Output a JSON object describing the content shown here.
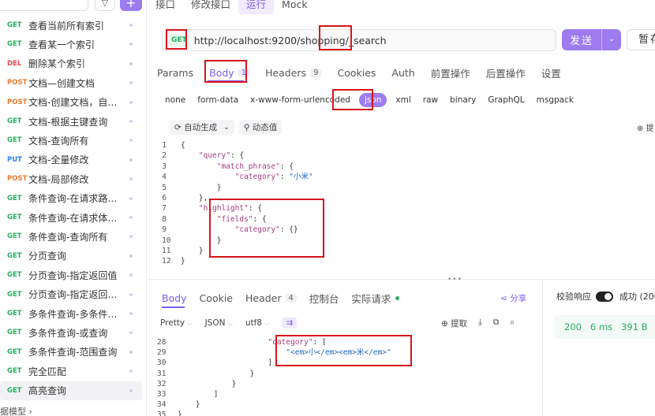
{
  "sidebar": {
    "search_placeholder": "",
    "filter_icon": "▽",
    "add_icon": "+",
    "items": [
      {
        "method": "GET",
        "name": "查看当前所有索引"
      },
      {
        "method": "GET",
        "name": "查看某一个索引"
      },
      {
        "method": "DEL",
        "name": "删除某个索引"
      },
      {
        "method": "POST",
        "name": "文档—创建文档"
      },
      {
        "method": "POST",
        "name": "文档-创建文档，自定..."
      },
      {
        "method": "GET",
        "name": "文档-根据主键查询"
      },
      {
        "method": "GET",
        "name": "文档-查询所有"
      },
      {
        "method": "PUT",
        "name": "文档-全量修改"
      },
      {
        "method": "POST",
        "name": "文档-局部修改"
      },
      {
        "method": "GET",
        "name": "条件查询-在请求路径..."
      },
      {
        "method": "GET",
        "name": "条件查询-在请求体中..."
      },
      {
        "method": "GET",
        "name": "条件查询-查询所有"
      },
      {
        "method": "GET",
        "name": "分页查询"
      },
      {
        "method": "GET",
        "name": "分页查询-指定返回值"
      },
      {
        "method": "GET",
        "name": "分页查询-指定返回值..."
      },
      {
        "method": "GET",
        "name": "多条件查询-多条件同..."
      },
      {
        "method": "GET",
        "name": "多条件查询-或查询"
      },
      {
        "method": "GET",
        "name": "多条件查询-范围查询"
      },
      {
        "method": "GET",
        "name": "完全匹配"
      },
      {
        "method": "GET",
        "name": "高亮查询"
      }
    ],
    "footer": "据模型 ›"
  },
  "top_tabs": [
    "接口",
    "修改接口",
    "运行",
    "Mock"
  ],
  "url": {
    "method": "GET",
    "value": "http://localhost:9200/shopping/_search"
  },
  "send_label": "发送",
  "send_caret": "⌄",
  "save_label": "暂存",
  "req_tabs": [
    {
      "label": "Params",
      "badge": ""
    },
    {
      "label": "Body",
      "badge": "1"
    },
    {
      "label": "Headers",
      "badge": "9"
    },
    {
      "label": "Cookies",
      "badge": ""
    },
    {
      "label": "Auth",
      "badge": ""
    },
    {
      "label": "前置操作",
      "badge": ""
    },
    {
      "label": "后置操作",
      "badge": ""
    },
    {
      "label": "设置",
      "badge": ""
    }
  ],
  "body_types": [
    "none",
    "form-data",
    "x-www-form-urlencoded",
    "json",
    "xml",
    "raw",
    "binary",
    "GraphQL",
    "msgpack"
  ],
  "editor_bar": {
    "autogen": "⟳ 自动生成",
    "autogen_caret": "⌄",
    "dynamic": "⚲ 动态值",
    "extract": "⊕ 提"
  },
  "request_code": [
    {
      "n": "1",
      "text": "{"
    },
    {
      "n": "2",
      "text": "    \"query\": {"
    },
    {
      "n": "3",
      "text": "        \"match_phrase\": {"
    },
    {
      "n": "4",
      "text": "            \"category\": \"小米\""
    },
    {
      "n": "5",
      "text": "        }"
    },
    {
      "n": "6",
      "text": "    },"
    },
    {
      "n": "7",
      "text": "    \"highlight\": {"
    },
    {
      "n": "8",
      "text": "        \"fields\": {"
    },
    {
      "n": "9",
      "text": "            \"category\": {}"
    },
    {
      "n": "10",
      "text": "        }"
    },
    {
      "n": "11",
      "text": "    }"
    },
    {
      "n": "12",
      "text": "}"
    }
  ],
  "split_dots": "•••",
  "resp_tabs": [
    {
      "label": "Body",
      "badge": ""
    },
    {
      "label": "Cookie",
      "badge": ""
    },
    {
      "label": "Header",
      "badge": "4"
    },
    {
      "label": "控制台",
      "badge": ""
    },
    {
      "label": "实际请求",
      "badge": ""
    }
  ],
  "share_label": "⋖ 分享",
  "format_bar": {
    "pretty": "Pretty",
    "json": "JSON",
    "encoding": "utf8",
    "chev": "⌵",
    "wrap": "⇉"
  },
  "format_right": {
    "extract": "⊕ 提取",
    "download": "⤓",
    "copy": "⧉",
    "search": "⌕"
  },
  "response_code": [
    {
      "n": "28",
      "text": "                    \"category\": ["
    },
    {
      "n": "29",
      "text": "                        \"<em>小</em><em>米</em>\""
    },
    {
      "n": "30",
      "text": "                    ]"
    },
    {
      "n": "31",
      "text": "                }"
    },
    {
      "n": "32",
      "text": "            }"
    },
    {
      "n": "33",
      "text": "        ]"
    },
    {
      "n": "34",
      "text": "    }"
    },
    {
      "n": "35",
      "text": "}"
    }
  ],
  "validate_label": "校验响应",
  "success_label": "成功 (200",
  "status": {
    "code": "200",
    "time": "6 ms",
    "size": "391 B"
  },
  "colors": {
    "accent": "#9d7cf0",
    "get": "#27ae60",
    "post": "#e8782a",
    "del": "#e5484d",
    "put": "#2f7cf6",
    "highlight_box": "#d9151b"
  }
}
